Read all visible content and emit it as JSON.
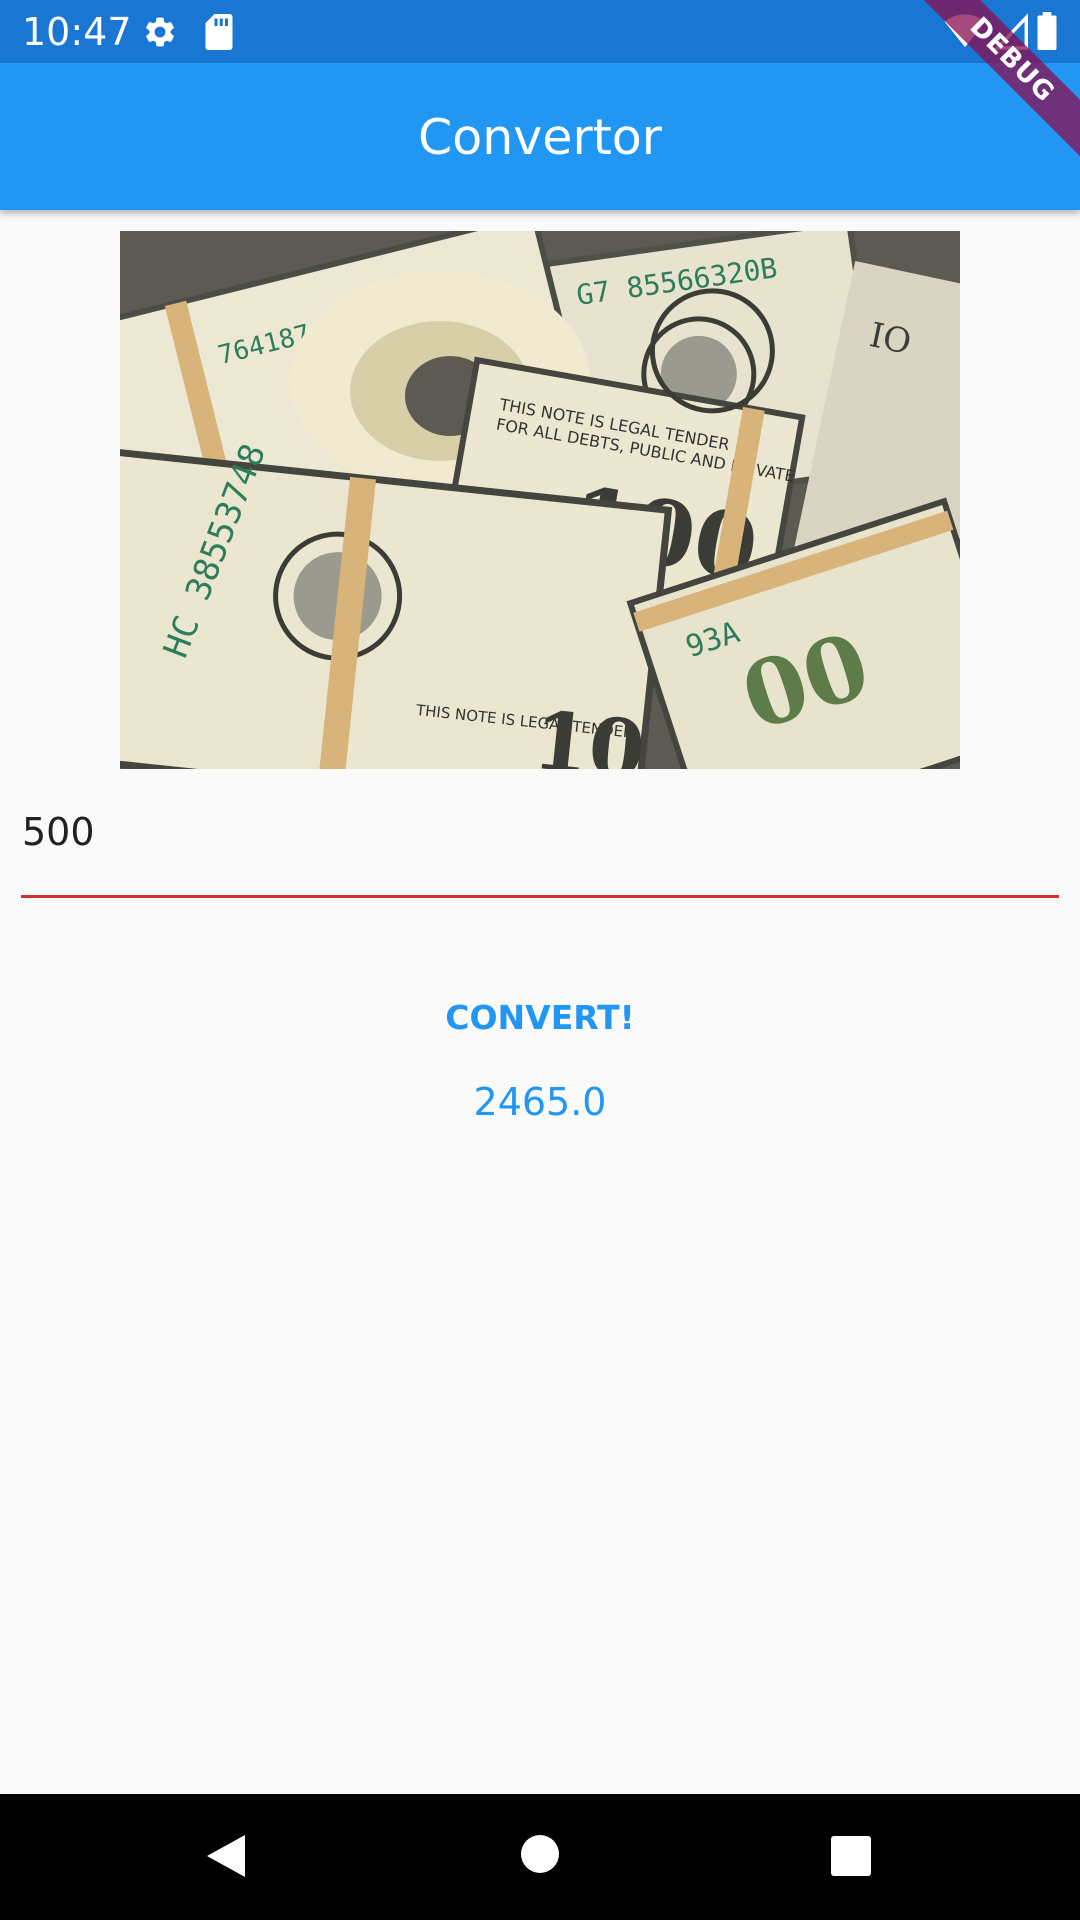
{
  "status_bar": {
    "time": "10:47",
    "icons": [
      "gear-icon",
      "sd-card-icon",
      "wifi-icon",
      "signal-icon",
      "battery-icon"
    ],
    "background": "#1976d2"
  },
  "debug_banner": {
    "label": "DEBUG",
    "color": "#880e4f"
  },
  "app_bar": {
    "title": "Convertor",
    "background": "#2196f3"
  },
  "hero_image": {
    "description_icon": "money-image"
  },
  "amount_input": {
    "value": "500",
    "underline_color": "#d32f2f"
  },
  "convert_button": {
    "label": "CONVERT!",
    "color": "#2196f3"
  },
  "result": {
    "value": "2465.0"
  },
  "nav_bar": {
    "buttons": [
      "back-icon",
      "home-icon",
      "recents-icon"
    ]
  }
}
